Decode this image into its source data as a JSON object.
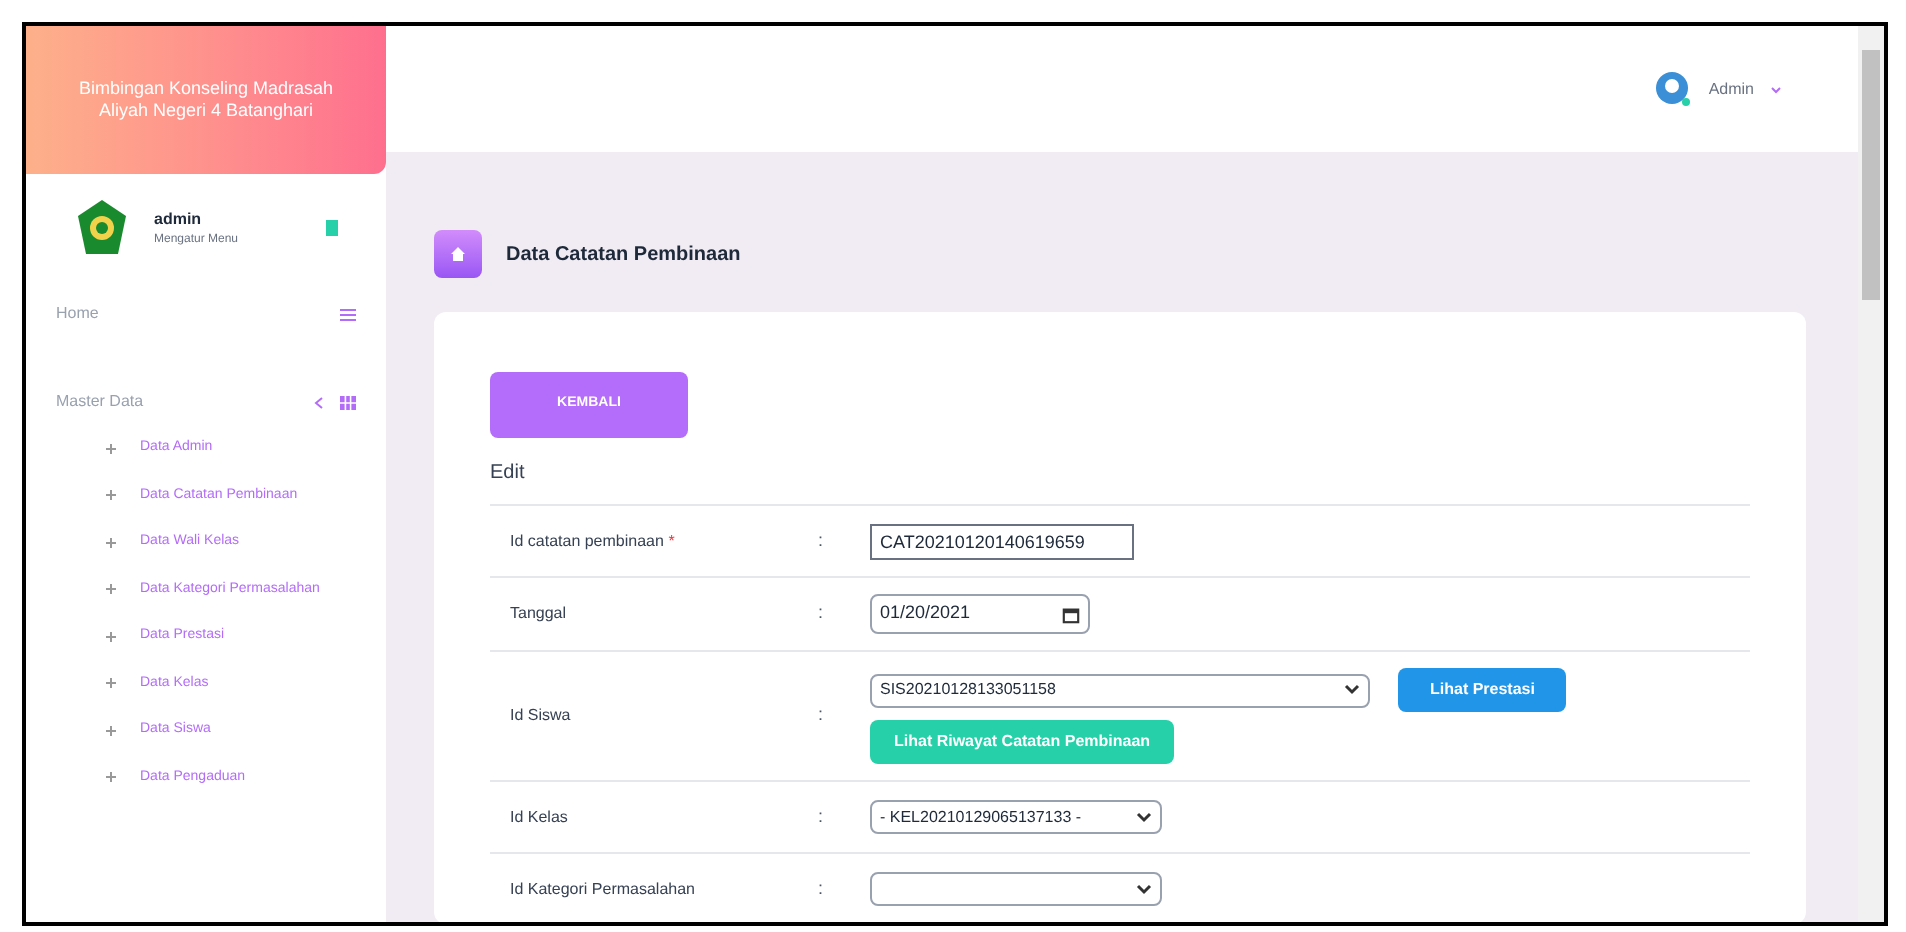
{
  "sidebar": {
    "brand": "Bimbingan Konseling Madrasah Aliyah Negeri 4 Batanghari",
    "user": {
      "name": "admin",
      "subtitle": "Mengatur Menu"
    },
    "home": {
      "label": "Home"
    },
    "master": {
      "label": "Master Data",
      "expanded": true,
      "items": [
        {
          "label": "Data Admin"
        },
        {
          "label": "Data Catatan Pembinaan"
        },
        {
          "label": "Data Wali Kelas"
        },
        {
          "label": "Data Kategori Permasalahan"
        },
        {
          "label": "Data Prestasi"
        },
        {
          "label": "Data Kelas"
        },
        {
          "label": "Data Siswa"
        },
        {
          "label": "Data Pengaduan"
        }
      ]
    }
  },
  "topbar": {
    "user": "Admin"
  },
  "page": {
    "title": "Data Catatan Pembinaan",
    "back_button": "KEMBALI",
    "section": "Edit",
    "rows": [
      {
        "kind": "text",
        "label": "Id catatan pembinaan",
        "required_mark": "*",
        "colon": ":",
        "value": "CAT20210120140619659"
      },
      {
        "kind": "date",
        "label": "Tanggal",
        "colon": ":",
        "value": "01/20/2021"
      },
      {
        "kind": "select-buttons",
        "label": "Id Siswa",
        "colon": ":",
        "value": "SIS20210128133051158",
        "side_button": "Lihat Prestasi",
        "below_button": "Lihat Riwayat Catatan Pembinaan"
      },
      {
        "kind": "select",
        "label": "Id Kelas",
        "colon": ":",
        "value": "- KEL20210129065137133 -"
      },
      {
        "kind": "select",
        "label": "Id Kategori Permasalahan",
        "colon": ":"
      }
    ]
  }
}
